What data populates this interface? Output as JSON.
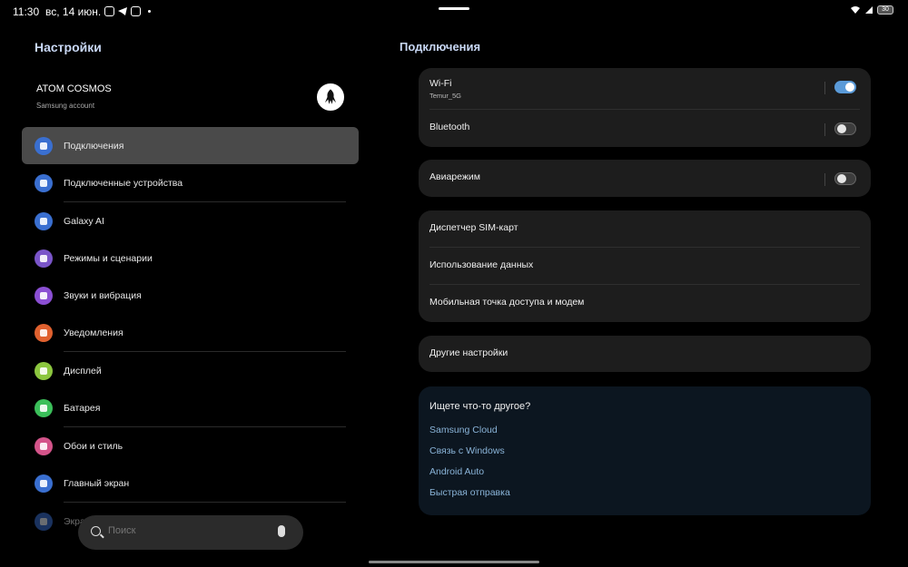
{
  "status": {
    "time": "11:30",
    "date": "вс, 14 июн.",
    "battery": "30",
    "colors": {
      "accent": "#5a9ad8",
      "link": "#8ab4d8",
      "title": "#c9d8f5"
    }
  },
  "left": {
    "title": "Настройки",
    "account": {
      "name": "ATOM COSMOS",
      "subtitle": "Samsung account"
    },
    "items": [
      {
        "label": "Подключения",
        "icon": "wifi-icon",
        "color": "#3a6fd0",
        "active": true
      },
      {
        "label": "Подключенные устройства",
        "icon": "devices-icon",
        "color": "#3a6fd0"
      },
      {
        "label": "Galaxy AI",
        "icon": "galaxy-ai-icon",
        "color": "#3a6fd0"
      },
      {
        "label": "Режимы и сценарии",
        "icon": "modes-icon",
        "color": "#7a55c9"
      },
      {
        "label": "Звуки и вибрация",
        "icon": "sound-icon",
        "color": "#8b4fd3"
      },
      {
        "label": "Уведомления",
        "icon": "notification-icon",
        "color": "#e0612f"
      },
      {
        "label": "Дисплей",
        "icon": "display-icon",
        "color": "#8cc63f"
      },
      {
        "label": "Батарея",
        "icon": "battery-icon",
        "color": "#3bbf5a"
      },
      {
        "label": "Обои и стиль",
        "icon": "wallpaper-icon",
        "color": "#d4548a"
      },
      {
        "label": "Главный экран",
        "icon": "home-icon",
        "color": "#3a6fd0"
      },
      {
        "label": "Экран блокировки",
        "icon": "lock-icon",
        "color": "#3a6fd0"
      }
    ],
    "search": {
      "placeholder": "Поиск"
    }
  },
  "right": {
    "title": "Подключения",
    "wifi": {
      "label": "Wi-Fi",
      "network": "Temur_5G",
      "enabled": true
    },
    "bluetooth": {
      "label": "Bluetooth",
      "enabled": false
    },
    "airplane": {
      "label": "Авиарежим",
      "enabled": false
    },
    "group": [
      "Диспетчер SIM-карт",
      "Использование данных",
      "Мобильная точка доступа и модем"
    ],
    "other": "Другие настройки",
    "more": {
      "title": "Ищете что-то другое?",
      "links": [
        "Samsung Cloud",
        "Связь с Windows",
        "Android Auto",
        "Быстрая отправка"
      ]
    }
  }
}
